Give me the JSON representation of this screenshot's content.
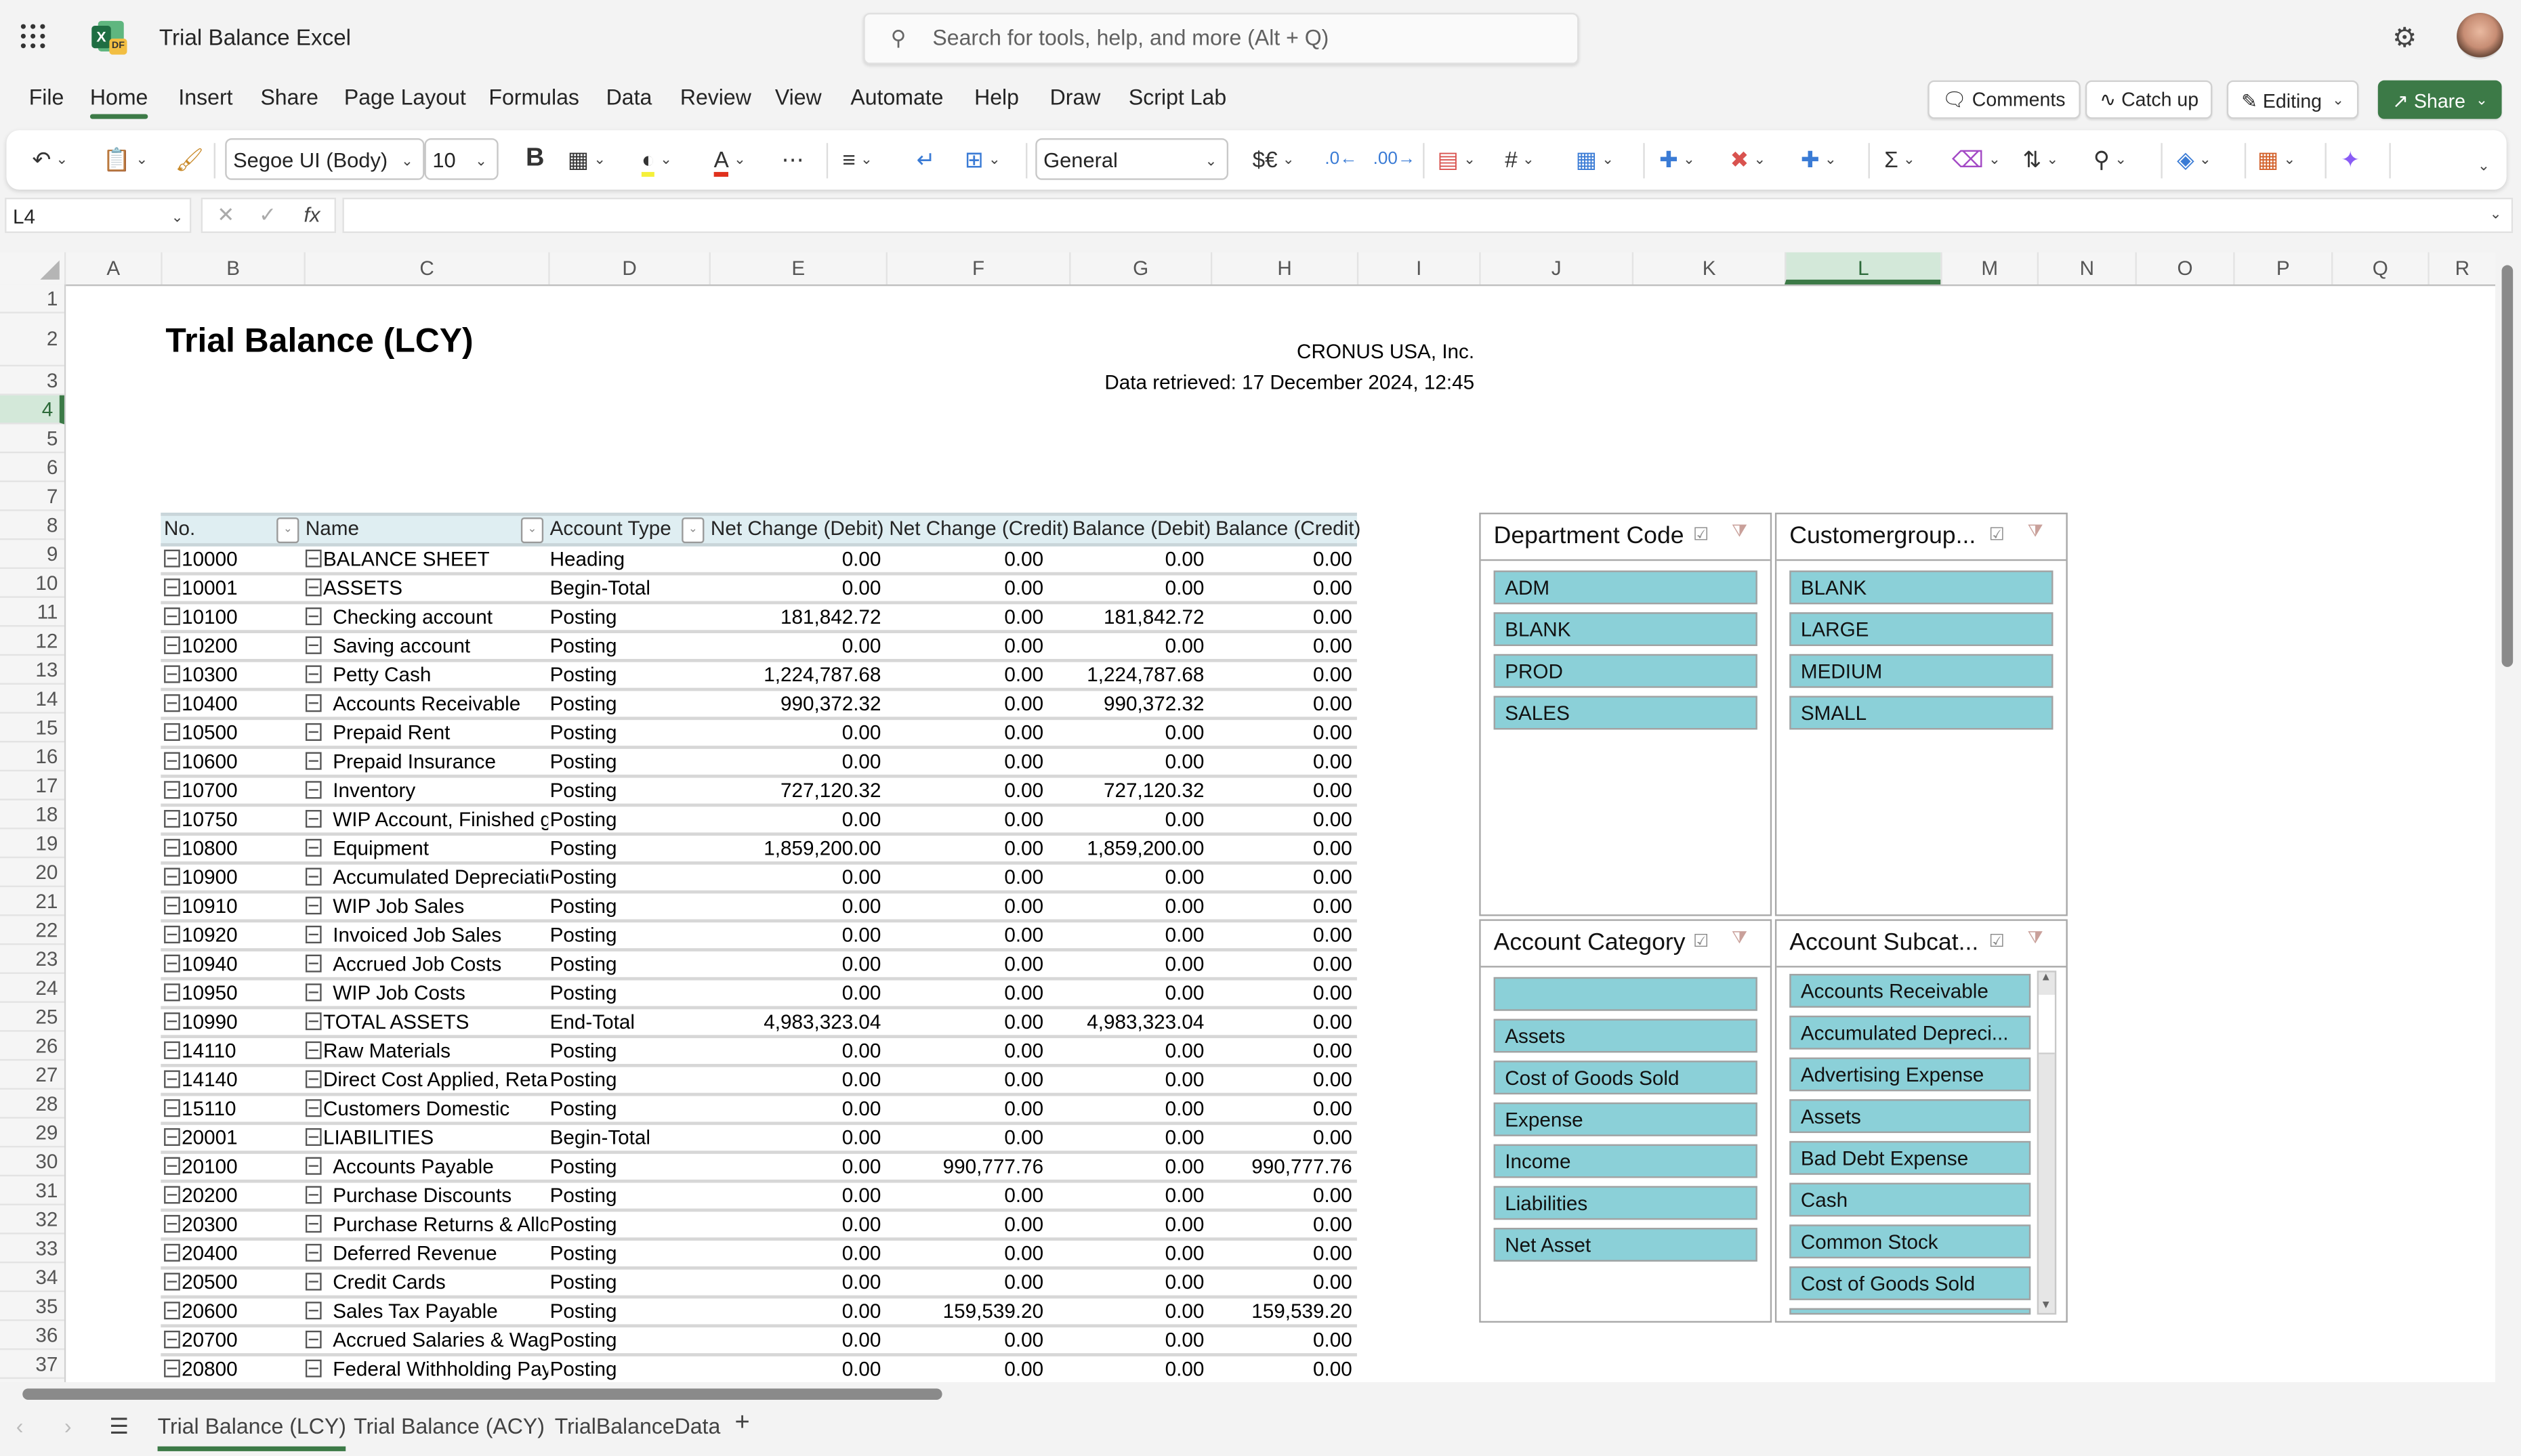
{
  "app": {
    "title": "Trial Balance Excel",
    "search_placeholder": "Search for tools, help, and more (Alt + Q)"
  },
  "menu": {
    "tabs": [
      "File",
      "Home",
      "Insert",
      "Share",
      "Page Layout",
      "Formulas",
      "Data",
      "Review",
      "View",
      "Automate",
      "Help",
      "Draw",
      "Script Lab"
    ],
    "active": "Home",
    "comments": "Comments",
    "catchup": "Catch up",
    "editing": "Editing",
    "share": "Share"
  },
  "ribbon": {
    "font_name": "Segoe UI (Body)",
    "font_size": "10",
    "number_format": "General",
    "bold": "B",
    "currency": "$€"
  },
  "formula_bar": {
    "name_box": "L4",
    "fx": "fx",
    "formula": ""
  },
  "grid": {
    "columns": [
      "A",
      "B",
      "C",
      "D",
      "E",
      "F",
      "G",
      "H",
      "I",
      "J",
      "K",
      "L",
      "M",
      "N",
      "O",
      "P",
      "Q",
      "R"
    ],
    "selected_column": "L",
    "rows": [
      "1",
      "2",
      "3",
      "4",
      "5",
      "6",
      "7",
      "8",
      "9",
      "10",
      "11",
      "12",
      "13",
      "14",
      "15",
      "16",
      "17",
      "18",
      "19",
      "20",
      "21",
      "22",
      "23",
      "24",
      "25",
      "26",
      "27",
      "28",
      "29",
      "30",
      "31",
      "32",
      "33",
      "34",
      "35",
      "36",
      "37"
    ],
    "selected_row": "4"
  },
  "report": {
    "title": "Trial Balance (LCY)",
    "company": "CRONUS USA, Inc.",
    "retrieved": "Data retrieved: 17 December 2024, 12:45"
  },
  "table": {
    "headers": [
      "No.",
      "Name",
      "Account Type",
      "Net Change (Debit)",
      "Net Change (Credit)",
      "Balance (Debit)",
      "Balance (Credit)"
    ],
    "rows": [
      {
        "no": "10000",
        "indent": 0,
        "name": "BALANCE SHEET",
        "type": "Heading",
        "ncd": "0.00",
        "ncc": "0.00",
        "bd": "0.00",
        "bc": "0.00"
      },
      {
        "no": "10001",
        "indent": 0,
        "name": "ASSETS",
        "type": "Begin-Total",
        "ncd": "0.00",
        "ncc": "0.00",
        "bd": "0.00",
        "bc": "0.00"
      },
      {
        "no": "10100",
        "indent": 1,
        "name": "Checking account",
        "type": "Posting",
        "ncd": "181,842.72",
        "ncc": "0.00",
        "bd": "181,842.72",
        "bc": "0.00"
      },
      {
        "no": "10200",
        "indent": 1,
        "name": "Saving account",
        "type": "Posting",
        "ncd": "0.00",
        "ncc": "0.00",
        "bd": "0.00",
        "bc": "0.00"
      },
      {
        "no": "10300",
        "indent": 1,
        "name": "Petty Cash",
        "type": "Posting",
        "ncd": "1,224,787.68",
        "ncc": "0.00",
        "bd": "1,224,787.68",
        "bc": "0.00"
      },
      {
        "no": "10400",
        "indent": 1,
        "name": "Accounts Receivable",
        "type": "Posting",
        "ncd": "990,372.32",
        "ncc": "0.00",
        "bd": "990,372.32",
        "bc": "0.00"
      },
      {
        "no": "10500",
        "indent": 1,
        "name": "Prepaid Rent",
        "type": "Posting",
        "ncd": "0.00",
        "ncc": "0.00",
        "bd": "0.00",
        "bc": "0.00"
      },
      {
        "no": "10600",
        "indent": 1,
        "name": "Prepaid Insurance",
        "type": "Posting",
        "ncd": "0.00",
        "ncc": "0.00",
        "bd": "0.00",
        "bc": "0.00"
      },
      {
        "no": "10700",
        "indent": 1,
        "name": "Inventory",
        "type": "Posting",
        "ncd": "727,120.32",
        "ncc": "0.00",
        "bd": "727,120.32",
        "bc": "0.00"
      },
      {
        "no": "10750",
        "indent": 1,
        "name": "WIP Account, Finished goods",
        "type": "Posting",
        "ncd": "0.00",
        "ncc": "0.00",
        "bd": "0.00",
        "bc": "0.00"
      },
      {
        "no": "10800",
        "indent": 1,
        "name": "Equipment",
        "type": "Posting",
        "ncd": "1,859,200.00",
        "ncc": "0.00",
        "bd": "1,859,200.00",
        "bc": "0.00"
      },
      {
        "no": "10900",
        "indent": 1,
        "name": "Accumulated Depreciation",
        "type": "Posting",
        "ncd": "0.00",
        "ncc": "0.00",
        "bd": "0.00",
        "bc": "0.00"
      },
      {
        "no": "10910",
        "indent": 1,
        "name": "WIP Job Sales",
        "type": "Posting",
        "ncd": "0.00",
        "ncc": "0.00",
        "bd": "0.00",
        "bc": "0.00"
      },
      {
        "no": "10920",
        "indent": 1,
        "name": "Invoiced Job Sales",
        "type": "Posting",
        "ncd": "0.00",
        "ncc": "0.00",
        "bd": "0.00",
        "bc": "0.00"
      },
      {
        "no": "10940",
        "indent": 1,
        "name": "Accrued Job Costs",
        "type": "Posting",
        "ncd": "0.00",
        "ncc": "0.00",
        "bd": "0.00",
        "bc": "0.00"
      },
      {
        "no": "10950",
        "indent": 1,
        "name": "WIP Job Costs",
        "type": "Posting",
        "ncd": "0.00",
        "ncc": "0.00",
        "bd": "0.00",
        "bc": "0.00"
      },
      {
        "no": "10990",
        "indent": 0,
        "name": "TOTAL ASSETS",
        "type": "End-Total",
        "ncd": "4,983,323.04",
        "ncc": "0.00",
        "bd": "4,983,323.04",
        "bc": "0.00"
      },
      {
        "no": "14110",
        "indent": 0,
        "name": "Raw Materials",
        "type": "Posting",
        "ncd": "0.00",
        "ncc": "0.00",
        "bd": "0.00",
        "bc": "0.00"
      },
      {
        "no": "14140",
        "indent": 0,
        "name": "Direct Cost Applied, Retail",
        "type": "Posting",
        "ncd": "0.00",
        "ncc": "0.00",
        "bd": "0.00",
        "bc": "0.00"
      },
      {
        "no": "15110",
        "indent": 0,
        "name": "Customers Domestic",
        "type": "Posting",
        "ncd": "0.00",
        "ncc": "0.00",
        "bd": "0.00",
        "bc": "0.00"
      },
      {
        "no": "20001",
        "indent": 0,
        "name": "LIABILITIES",
        "type": "Begin-Total",
        "ncd": "0.00",
        "ncc": "0.00",
        "bd": "0.00",
        "bc": "0.00"
      },
      {
        "no": "20100",
        "indent": 1,
        "name": "Accounts Payable",
        "type": "Posting",
        "ncd": "0.00",
        "ncc": "990,777.76",
        "bd": "0.00",
        "bc": "990,777.76"
      },
      {
        "no": "20200",
        "indent": 1,
        "name": "Purchase Discounts",
        "type": "Posting",
        "ncd": "0.00",
        "ncc": "0.00",
        "bd": "0.00",
        "bc": "0.00"
      },
      {
        "no": "20300",
        "indent": 1,
        "name": "Purchase Returns & Allowances",
        "type": "Posting",
        "ncd": "0.00",
        "ncc": "0.00",
        "bd": "0.00",
        "bc": "0.00"
      },
      {
        "no": "20400",
        "indent": 1,
        "name": "Deferred Revenue",
        "type": "Posting",
        "ncd": "0.00",
        "ncc": "0.00",
        "bd": "0.00",
        "bc": "0.00"
      },
      {
        "no": "20500",
        "indent": 1,
        "name": "Credit Cards",
        "type": "Posting",
        "ncd": "0.00",
        "ncc": "0.00",
        "bd": "0.00",
        "bc": "0.00"
      },
      {
        "no": "20600",
        "indent": 1,
        "name": "Sales Tax Payable",
        "type": "Posting",
        "ncd": "0.00",
        "ncc": "159,539.20",
        "bd": "0.00",
        "bc": "159,539.20"
      },
      {
        "no": "20700",
        "indent": 1,
        "name": "Accrued Salaries & Wages",
        "type": "Posting",
        "ncd": "0.00",
        "ncc": "0.00",
        "bd": "0.00",
        "bc": "0.00"
      },
      {
        "no": "20800",
        "indent": 1,
        "name": "Federal Withholding Payable",
        "type": "Posting",
        "ncd": "0.00",
        "ncc": "0.00",
        "bd": "0.00",
        "bc": "0.00"
      }
    ]
  },
  "slicers": [
    {
      "title": "Department Code",
      "items": [
        "ADM",
        "BLANK",
        "PROD",
        "SALES"
      ]
    },
    {
      "title": "Customergroup...",
      "items": [
        "BLANK",
        "LARGE",
        "MEDIUM",
        "SMALL"
      ]
    },
    {
      "title": "Account Category",
      "items": [
        "",
        "Assets",
        "Cost of Goods Sold",
        "Expense",
        "Income",
        "Liabilities",
        "Net Asset"
      ]
    },
    {
      "title": "Account Subcat...",
      "items": [
        "Accounts Receivable",
        "Accumulated Depreci...",
        "Advertising Expense",
        "Assets",
        "Bad Debt Expense",
        "Cash",
        "Common Stock",
        "Cost of Goods Sold"
      ]
    }
  ],
  "colors": {
    "accent": "#3c7a47",
    "slicer_item": "#8bd0d8",
    "table_header": "#dfeef2"
  },
  "sheet_tabs": {
    "tabs": [
      "Trial Balance (LCY)",
      "Trial Balance (ACY)",
      "TrialBalanceData"
    ],
    "active": "Trial Balance (LCY)",
    "add": "+"
  }
}
